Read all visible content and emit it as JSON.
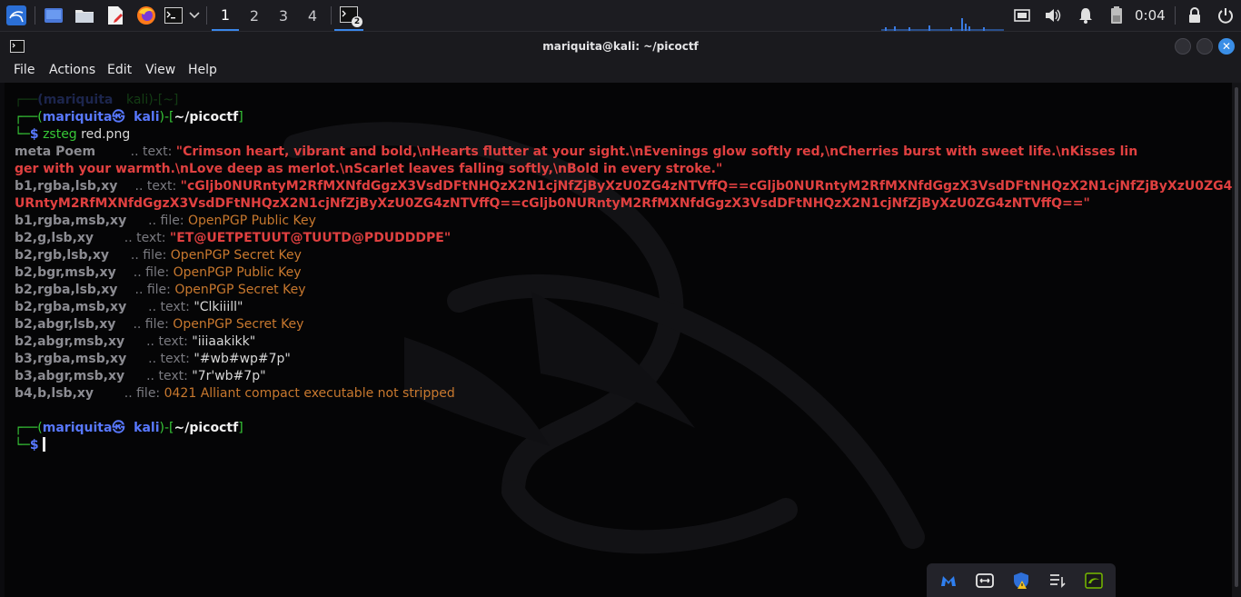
{
  "taskbar": {
    "workspaces": [
      "1",
      "2",
      "3",
      "4"
    ],
    "active_workspace": "1",
    "terminal_badge": "2",
    "clock": "0:04"
  },
  "window": {
    "title": "mariquita@kali: ~/picoctf",
    "close_glyph": "✕"
  },
  "menu": [
    "File",
    "Actions",
    "Edit",
    "View",
    "Help"
  ],
  "terminal": {
    "prompt_ghost": {
      "user": "(mariquita",
      "host": "kali)-[~]"
    },
    "prompt1": {
      "open": "┌──(",
      "user": "mariquita",
      "skull": "㉿",
      "host": "kali",
      "mid": ")-[",
      "path": "~/picoctf",
      "close": "]",
      "corner": "└─",
      "dollar": "$",
      "command": "zsteg",
      "argument": "red.png"
    },
    "output": [
      {
        "key": "meta Poem",
        "sep": " .. text: ",
        "value": "\"Crimson heart, vibrant and bold,\\nHearts flutter at your sight.\\nEvenings glow softly red,\\nCherries burst with sweet life.\\nKisses lin"
      },
      {
        "cont": "ger with your warmth.\\nLove deep as merlot.\\nScarlet leaves falling softly,\\nBold in every stroke.\""
      },
      {
        "key": "b1,rgba,lsb,xy",
        "sep": " .. text: ",
        "value": "\"cGljb0NURntyM2RfMXNfdGgzX3VsdDFtNHQzX2N1cjNfZjByXzU0ZG4zNTVffQ==cGljb0NURntyM2RfMXNfdGgzX3VsdDFtNHQzX2N1cjNfZjByXzU0ZG4zNTVffQ==cGlj"
      },
      {
        "cont": "URntyM2RfMXNfdGgzX3VsdDFtNHQzX2N1cjNfZjByXzU0ZG4zNTVffQ==cGljb0NURntyM2RfMXNfdGgzX3VsdDFtNHQzX2N1cjNfZjByXzU0ZG4zNTVffQ==\""
      },
      {
        "key": "b1,rgba,msb,xy",
        "sep": " .. file: ",
        "value": "OpenPGP Public Key"
      },
      {
        "key": "b2,g,lsb,xy",
        "sep": " .. text: ",
        "value": "\"ET@UETPETUUT@TUUTD@PDUDDDPE\""
      },
      {
        "key": "b2,rgb,lsb,xy",
        "sep": " .. file: ",
        "value": "OpenPGP Secret Key"
      },
      {
        "key": "b2,bgr,msb,xy",
        "sep": " .. file: ",
        "value": "OpenPGP Public Key"
      },
      {
        "key": "b2,rgba,lsb,xy",
        "sep": " .. file: ",
        "value": "OpenPGP Secret Key"
      },
      {
        "key": "b2,rgba,msb,xy",
        "sep": " .. text: ",
        "value": "\"Clkiiill\""
      },
      {
        "key": "b2,abgr,lsb,xy",
        "sep": " .. file: ",
        "value": "OpenPGP Secret Key"
      },
      {
        "key": "b2,abgr,msb,xy",
        "sep": " .. text: ",
        "value": "\"iiiaakikk\""
      },
      {
        "key": "b3,rgba,msb,xy",
        "sep": " .. text: ",
        "value": "\"#wb#wp#7p\""
      },
      {
        "key": "b3,abgr,msb,xy",
        "sep": " .. text: ",
        "value": "\"7r'wb#7p\""
      },
      {
        "key": "b4,b,lsb,xy",
        "sep": " .. file: ",
        "value": "0421 Alliant compact executable not stripped"
      }
    ],
    "prompt2": {
      "open": "┌──(",
      "user": "mariquita",
      "skull": "㉿",
      "host": "kali",
      "mid": ")-[",
      "path": "~/picoctf",
      "close": "]",
      "corner": "└─",
      "dollar": "$"
    }
  }
}
